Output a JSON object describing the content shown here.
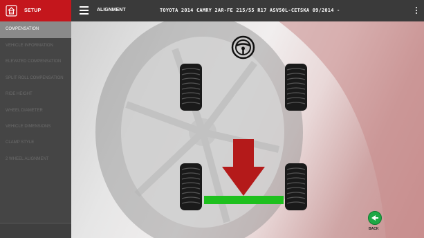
{
  "header": {
    "setup_label": "SETUP",
    "module_label": "ALIGNMENT",
    "vehicle": "TOYOTA 2014 CAMRY 2AR-FE 215/55 R17 ASV50L-CETSKA 09/2014 -"
  },
  "sidebar": {
    "items": [
      {
        "label": "COMPENSATION",
        "active": true
      },
      {
        "label": "VEHICLE INFORMATION",
        "active": false
      },
      {
        "label": "ELEVATED COMPENSATION",
        "active": false
      },
      {
        "label": "SPLIT ROLL COMPENSATION",
        "active": false
      },
      {
        "label": "RIDE HEIGHT",
        "active": false
      },
      {
        "label": "WHEEL DIAMETER",
        "active": false
      },
      {
        "label": "VEHICLE DIMENSIONS",
        "active": false
      },
      {
        "label": "CLAMP STYLE",
        "active": false
      },
      {
        "label": "2 WHEEL ALIGNMENT",
        "active": false
      }
    ]
  },
  "diagram": {
    "steering_wheel_icon": "steering-wheel-icon",
    "arrow_color": "#b41a1a",
    "bar_color": "#1ec01e",
    "tire_color": "#1a1a1a"
  },
  "back_button": {
    "label": "BACK",
    "color": "#1fa845"
  },
  "colors": {
    "setup_tab": "#c4161c",
    "topbar": "#3a3a3a",
    "sidebar": "#454545",
    "sidebar_active": "#8a8a8a"
  }
}
